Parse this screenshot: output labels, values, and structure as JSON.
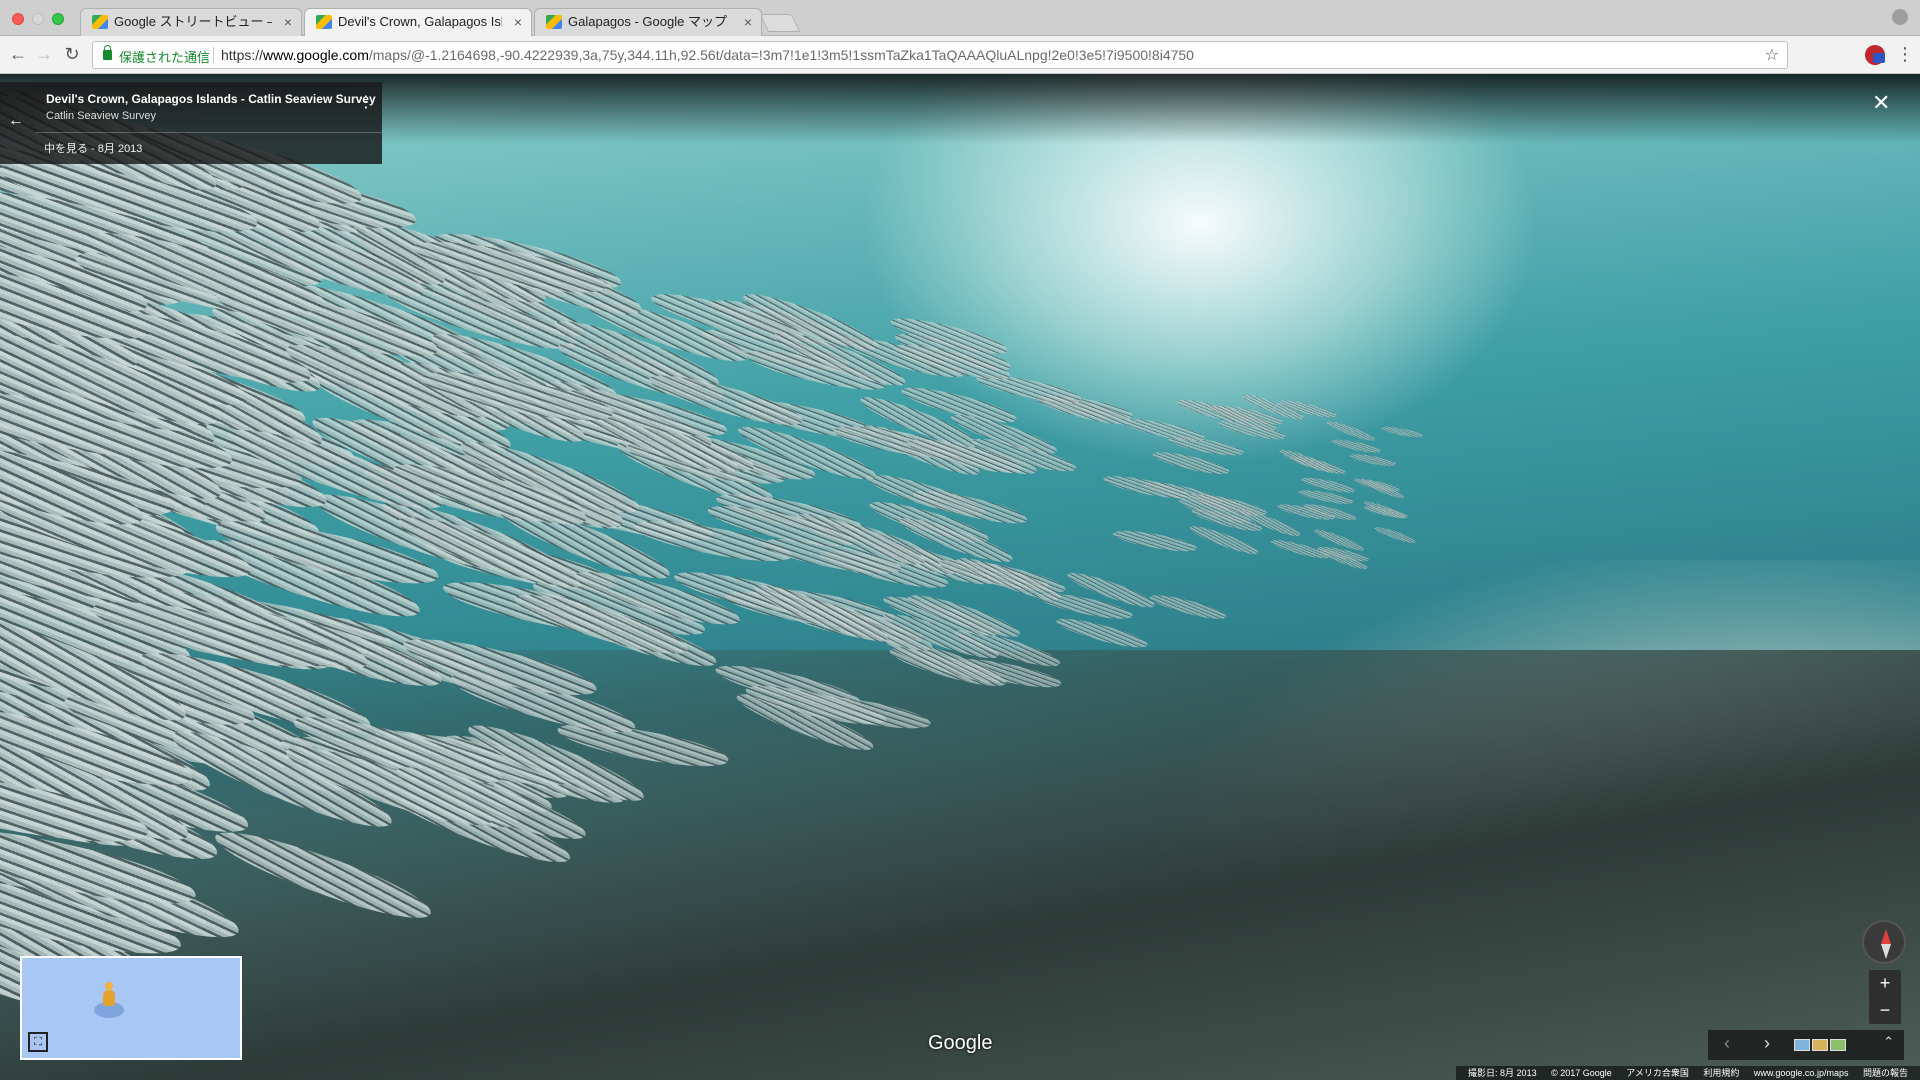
{
  "browser": {
    "tabs": [
      {
        "title": "Google ストリートビュー – 絶景で",
        "active": false
      },
      {
        "title": "Devil's Crown, Galapagos Islan",
        "active": true
      },
      {
        "title": "Galapagos - Google マップ",
        "active": false
      }
    ],
    "security_label": "保護された通信",
    "url_scheme": "https://",
    "url_host": "www.google.com",
    "url_path": "/maps/@-1.2164698,-90.4222939,3a,75y,344.11h,92.56t/data=!3m7!1e1!3m5!1ssmTaZka1TaQAAAQluALnpg!2e0!3e5!7i9500!8i4750",
    "icons": {
      "back": "back-arrow-icon",
      "forward": "forward-arrow-icon",
      "reload": "reload-icon",
      "star": "star-icon",
      "menu": "more-vert-icon"
    }
  },
  "streetview": {
    "place_title": "Devil's Crown, Galapagos Islands - Catlin Seaview Survey",
    "subtitle": "Catlin Seaview Survey",
    "date_label": "中を見る - 8月 2013",
    "google_logo": "Google",
    "zoom_in": "+",
    "zoom_out": "−",
    "footer": {
      "capture_date": "撮影日: 8月 2013",
      "copyright": "© 2017 Google",
      "region": "アメリカ合衆国",
      "terms": "利用規約",
      "site": "www.google.co.jp/maps",
      "report": "問題の報告"
    }
  }
}
